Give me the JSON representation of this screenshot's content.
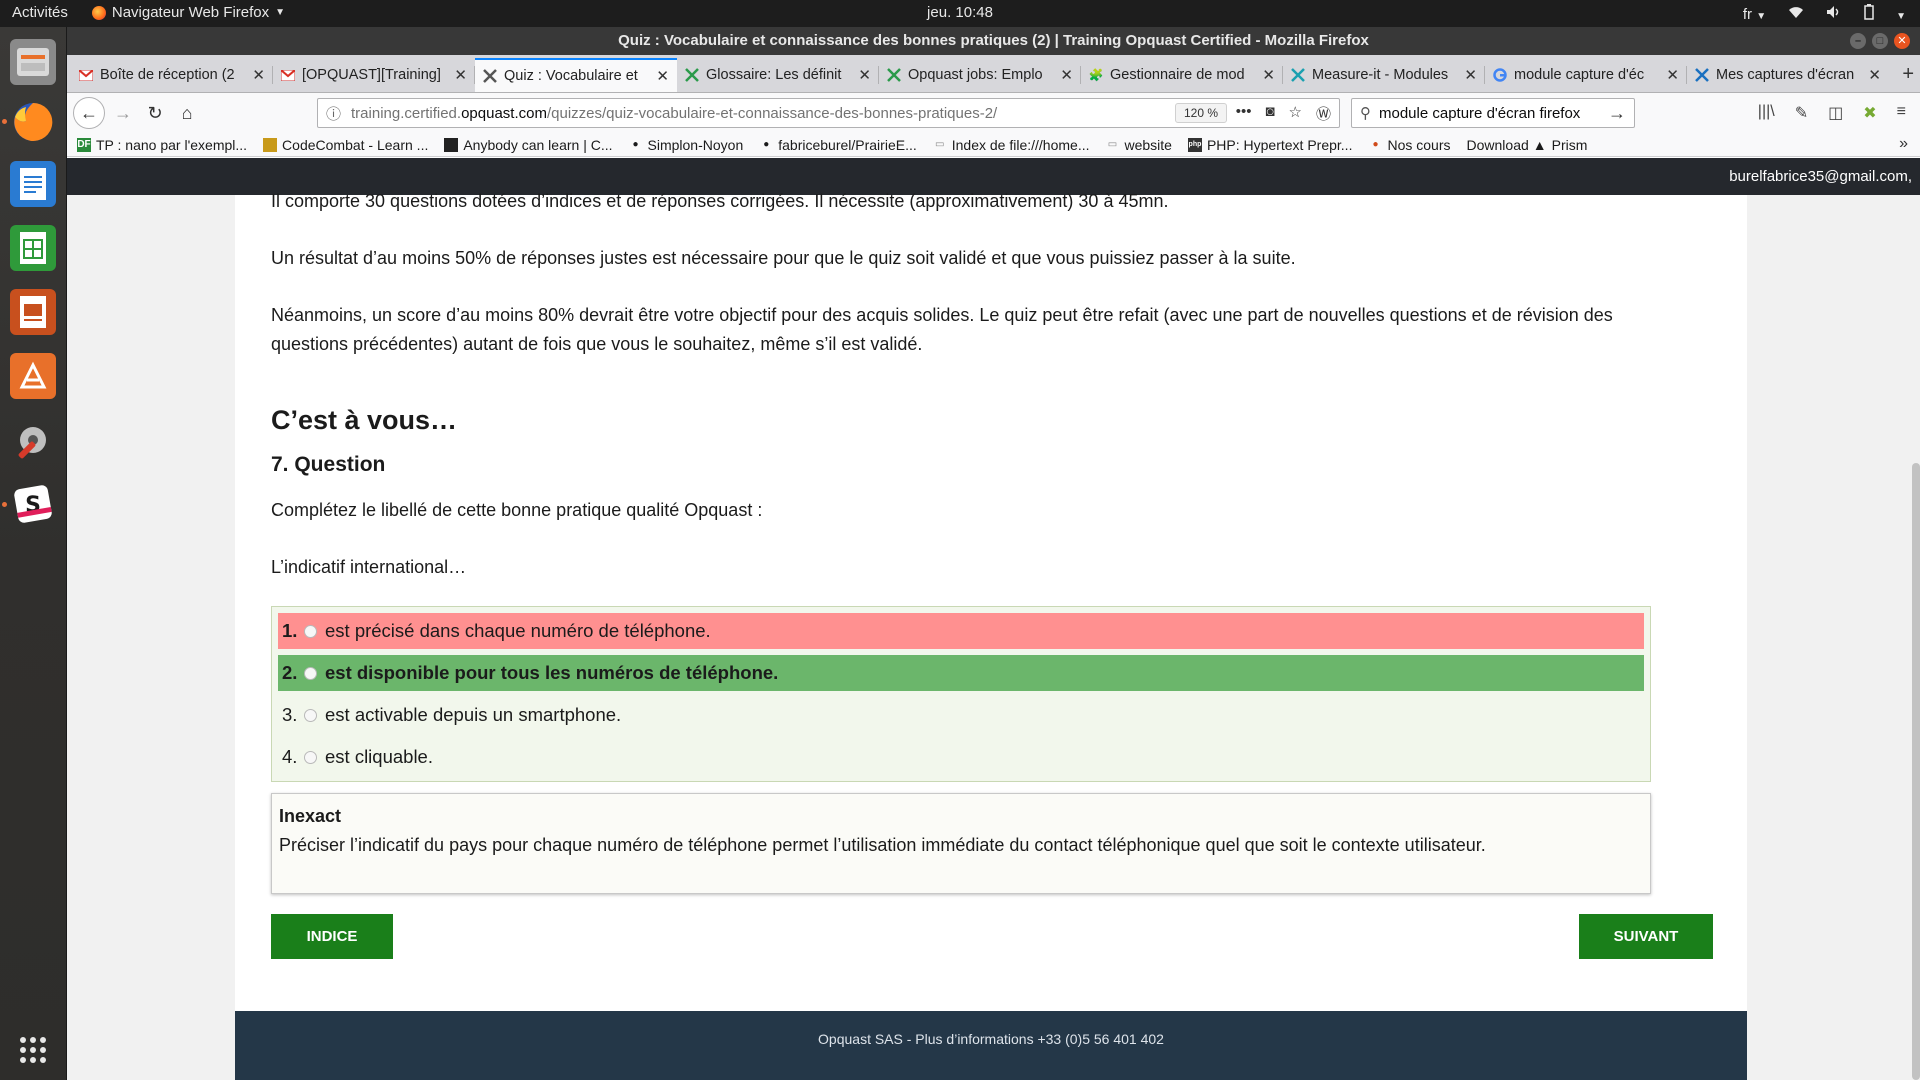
{
  "topbar": {
    "activities": "Activités",
    "app_name": "Navigateur Web Firefox",
    "clock": "jeu. 10:48",
    "lang": "fr"
  },
  "window": {
    "title": "Quiz : Vocabulaire et connaissance des bonnes pratiques (2) | Training Opquast Certified - Mozilla Firefox"
  },
  "tabs": [
    {
      "title": "Boîte de réception (2",
      "icon": "gmail-icon",
      "active": false
    },
    {
      "title": "[OPQUAST][Training]",
      "icon": "gmail-icon",
      "active": false
    },
    {
      "title": "Quiz : Vocabulaire et",
      "icon": "opquast-icon",
      "active": true
    },
    {
      "title": "Glossaire: Les définit",
      "icon": "opquast-icon",
      "active": false
    },
    {
      "title": "Opquast jobs: Emplo",
      "icon": "opquast-icon",
      "active": false
    },
    {
      "title": "Gestionnaire de mod",
      "icon": "puzzle-icon",
      "active": false
    },
    {
      "title": "Measure-it - Modules",
      "icon": "measure-icon",
      "active": false
    },
    {
      "title": "module capture d'éc",
      "icon": "google-icon",
      "active": false
    },
    {
      "title": "Mes captures d'écran",
      "icon": "screenshot-icon",
      "active": false
    }
  ],
  "urlbar": {
    "prefix": "training.certified.",
    "domain": "opquast.com",
    "path": "/quizzes/quiz-vocabulaire-et-connaissance-des-bonnes-pratiques-2/",
    "zoom": "120 %"
  },
  "search": {
    "value": "module capture d'écran firefox"
  },
  "bookmarks": [
    {
      "label": "TP : nano par l'exempl...",
      "icon": "DF"
    },
    {
      "label": "CodeCombat - Learn ...",
      "icon": "CC"
    },
    {
      "label": "Anybody can learn | C...",
      "icon": "AC"
    },
    {
      "label": "Simplon-Noyon",
      "icon": "GH"
    },
    {
      "label": "fabriceburel/PrairieE...",
      "icon": "GH"
    },
    {
      "label": "Index de file:///home...",
      "icon": "IX"
    },
    {
      "label": "website",
      "icon": "WB"
    },
    {
      "label": "PHP: Hypertext Prepr...",
      "icon": "PHP"
    },
    {
      "label": "Nos cours",
      "icon": "NC"
    },
    {
      "label": "Download",
      "icon": ""
    },
    {
      "label": "Prism",
      "icon": "▲"
    }
  ],
  "page": {
    "user_email": "burelfabrice35@gmail.com,",
    "intro": [
      "Il comporte 30 questions dotées d’indices et de réponses corrigées. Il nécessite (approximativement) 30 à 45mn.",
      "Un résultat d’au moins 50% de réponses justes est nécessaire pour que le quiz soit validé et que vous puissiez passer à la suite.",
      "Néanmoins, un score d’au moins 80% devrait être votre objectif pour des acquis solides. Le quiz peut être refait (avec une part de nouvelles questions et de révision des questions précédentes) autant de fois que vous le souhaitez, même s’il est validé."
    ],
    "heading": "C’est à vous…",
    "question_number": "7. Question",
    "question_prompt": "Complétez le libellé de cette bonne pratique qualité Opquast :",
    "question_stem": "L’indicatif international…",
    "answers": [
      {
        "num": "1.",
        "text": "est précisé dans chaque numéro de téléphone.",
        "state": "wrong"
      },
      {
        "num": "2.",
        "text": "est disponible pour tous les numéros de téléphone.",
        "state": "correct"
      },
      {
        "num": "3.",
        "text": "est activable depuis un smartphone.",
        "state": "neutral"
      },
      {
        "num": "4.",
        "text": "est cliquable.",
        "state": "neutral"
      }
    ],
    "feedback_title": "Inexact",
    "feedback_text": "Préciser l’indicatif du pays pour chaque numéro de téléphone permet l’utilisation immédiate du contact téléphonique quel que soit le contexte utilisateur.",
    "hint_button": "INDICE",
    "next_button": "SUIVANT",
    "footer": "Opquast SAS - Plus d’informations +33 (0)5 56 401 402"
  },
  "colors": {
    "wrong_answer": "#ff9090",
    "correct_answer": "#6bb66b",
    "button_green": "#1a7f1a",
    "footer_bg": "#243748",
    "header_bg": "#25282d"
  }
}
